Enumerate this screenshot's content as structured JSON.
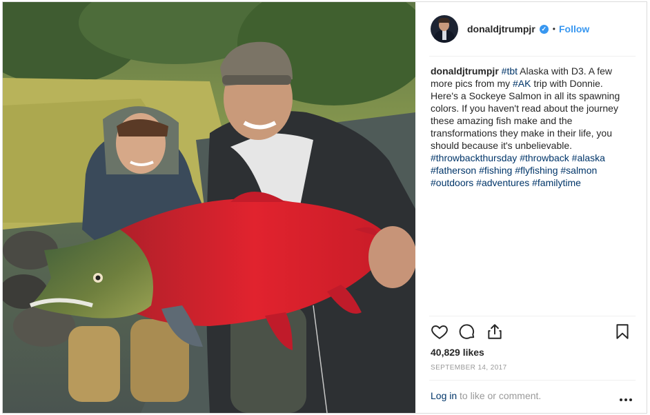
{
  "post": {
    "photo_alt": "Photo",
    "username": "donaldjtrumpjr",
    "verified_symbol": "✓",
    "separator": "•",
    "follow_label": "Follow",
    "caption": {
      "username": "donaldjtrumpjr",
      "segments": [
        {
          "type": "tag",
          "text": "#tbt"
        },
        {
          "type": "text",
          "text": " Alaska with D3. A few more pics from my "
        },
        {
          "type": "tag",
          "text": "#AK"
        },
        {
          "type": "text",
          "text": " trip with Donnie. Here's a Sockeye Salmon in all its spawning colors. If you haven't read about the journey these amazing fish make and the transformations they make in their life, you should because it's unbelievable. "
        },
        {
          "type": "tag",
          "text": "#throwbackthursday"
        },
        {
          "type": "text",
          "text": " "
        },
        {
          "type": "tag",
          "text": "#throwback"
        },
        {
          "type": "text",
          "text": " "
        },
        {
          "type": "tag",
          "text": "#alaska"
        },
        {
          "type": "text",
          "text": " "
        },
        {
          "type": "tag",
          "text": "#fatherson"
        },
        {
          "type": "text",
          "text": " "
        },
        {
          "type": "tag",
          "text": "#fishing"
        },
        {
          "type": "text",
          "text": " "
        },
        {
          "type": "tag",
          "text": "#flyfishing"
        },
        {
          "type": "text",
          "text": " "
        },
        {
          "type": "tag",
          "text": "#salmon"
        },
        {
          "type": "text",
          "text": " "
        },
        {
          "type": "tag",
          "text": "#outdoors"
        },
        {
          "type": "text",
          "text": " "
        },
        {
          "type": "tag",
          "text": "#adventures"
        },
        {
          "type": "text",
          "text": " "
        },
        {
          "type": "tag",
          "text": "#familytime"
        }
      ]
    },
    "icons": {
      "like": "heart-icon",
      "comment": "comment-icon",
      "share": "share-icon",
      "save": "bookmark-icon",
      "more": "more-options-icon"
    },
    "likes": "40,829 likes",
    "date": "SEPTEMBER 14, 2017",
    "comment_bar": {
      "login_label": "Log in",
      "rest_text": " to like or comment."
    }
  },
  "colors": {
    "link_blue": "#3897f0",
    "hashtag": "#003569",
    "muted": "#999999",
    "text": "#262626"
  }
}
